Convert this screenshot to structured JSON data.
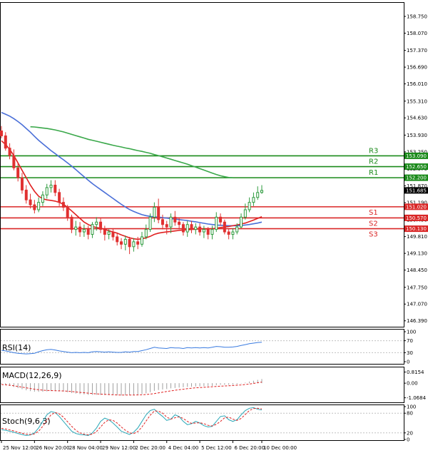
{
  "colors": {
    "bull": "#2e9b3e",
    "bear": "#e03030",
    "resistance": "#1a8a1a",
    "support": "#d92626",
    "ma_fast": "#e02020",
    "ma_mid": "#4a6fd8",
    "ma_slow": "#3aa84a",
    "rsi": "#3a7be0",
    "macd_signal": "#e02020",
    "macd_hist": "#a0a0a0",
    "stoch_main": "#2aa8b8",
    "stoch_signal": "#e02020",
    "last_price": "#000000"
  },
  "chart_data": [
    {
      "type": "candlestick",
      "x": [
        "25 Nov 12:00",
        "25 Nov 16:00",
        "25 Nov 20:00",
        "26 Nov 00:00",
        "26 Nov 04:00",
        "26 Nov 08:00",
        "26 Nov 12:00",
        "26 Nov 16:00",
        "26 Nov 20:00",
        "27 Nov 00:00",
        "27 Nov 04:00",
        "27 Nov 08:00",
        "27 Nov 12:00",
        "27 Nov 16:00",
        "27 Nov 20:00",
        "28 Nov 00:00",
        "28 Nov 04:00",
        "28 Nov 08:00",
        "28 Nov 12:00",
        "28 Nov 16:00",
        "28 Nov 20:00",
        "29 Nov 00:00",
        "29 Nov 04:00",
        "29 Nov 08:00",
        "29 Nov 12:00",
        "29 Nov 16:00",
        "29 Nov 20:00",
        "30 Nov 00:00",
        "30 Nov 04:00",
        "30 Nov 08:00",
        "2 Dec 12:00",
        "2 Dec 16:00",
        "2 Dec 20:00",
        "3 Dec 00:00",
        "3 Dec 04:00",
        "3 Dec 08:00",
        "3 Dec 12:00",
        "3 Dec 16:00",
        "3 Dec 20:00",
        "4 Dec 00:00",
        "4 Dec 04:00",
        "4 Dec 08:00",
        "4 Dec 12:00",
        "4 Dec 16:00",
        "4 Dec 20:00",
        "5 Dec 00:00",
        "5 Dec 04:00",
        "5 Dec 08:00",
        "5 Dec 12:00",
        "5 Dec 16:00",
        "5 Dec 20:00",
        "6 Dec 00:00",
        "6 Dec 04:00",
        "6 Dec 08:00",
        "6 Dec 12:00",
        "6 Dec 16:00",
        "6 Dec 20:00",
        "9 Dec 00:00",
        "9 Dec 04:00",
        "9 Dec 08:00",
        "9 Dec 12:00",
        "9 Dec 16:00",
        "9 Dec 20:00",
        "10 Dec 00:00"
      ],
      "open": [
        154.1,
        153.9,
        153.4,
        153.1,
        152.6,
        152.2,
        151.7,
        151.3,
        151.1,
        150.9,
        151.2,
        151.5,
        151.8,
        151.9,
        151.6,
        151.2,
        151.0,
        150.6,
        150.1,
        150.2,
        150.0,
        150.1,
        149.9,
        150.3,
        150.4,
        150.1,
        149.9,
        150.0,
        149.8,
        149.6,
        149.5,
        149.7,
        149.4,
        149.6,
        149.5,
        149.8,
        150.1,
        150.6,
        151.0,
        150.5,
        150.3,
        150.2,
        150.6,
        150.4,
        150.3,
        150.0,
        150.3,
        150.1,
        150.2,
        150.0,
        150.1,
        149.9,
        150.1,
        150.6,
        150.4,
        150.0,
        149.9,
        150.0,
        150.2,
        150.6,
        150.9,
        151.2,
        151.4,
        151.6
      ],
      "high": [
        154.3,
        154.05,
        153.6,
        153.35,
        152.8,
        152.4,
        151.9,
        151.55,
        151.3,
        151.4,
        151.65,
        151.95,
        152.1,
        152.1,
        151.75,
        151.4,
        151.1,
        150.7,
        150.45,
        150.4,
        150.3,
        150.25,
        150.4,
        150.6,
        150.55,
        150.25,
        150.1,
        150.15,
        149.95,
        149.75,
        149.85,
        149.8,
        149.75,
        149.8,
        150.0,
        150.3,
        150.75,
        151.2,
        151.35,
        150.7,
        150.45,
        150.75,
        150.85,
        150.55,
        150.4,
        150.45,
        150.45,
        150.35,
        150.35,
        150.25,
        150.2,
        150.25,
        150.8,
        150.75,
        150.5,
        150.15,
        150.15,
        150.35,
        150.75,
        151.15,
        151.4,
        151.6,
        151.85,
        151.9
      ],
      "low": [
        153.8,
        153.3,
        152.95,
        152.5,
        152.05,
        151.55,
        151.15,
        150.95,
        150.75,
        150.8,
        151.05,
        151.35,
        151.6,
        151.45,
        151.05,
        150.85,
        150.45,
        149.95,
        149.85,
        149.8,
        149.8,
        149.7,
        149.75,
        150.05,
        149.95,
        149.65,
        149.7,
        149.65,
        149.45,
        149.3,
        149.25,
        149.1,
        149.2,
        149.3,
        149.4,
        149.7,
        150.0,
        150.4,
        150.35,
        150.1,
        149.9,
        149.95,
        150.25,
        150.1,
        149.85,
        149.8,
        149.95,
        149.9,
        149.85,
        149.75,
        149.7,
        149.7,
        150.0,
        150.25,
        149.9,
        149.7,
        149.7,
        149.9,
        150.15,
        150.5,
        150.8,
        151.05,
        151.3,
        151.55
      ],
      "close": [
        153.9,
        153.4,
        153.1,
        152.6,
        152.2,
        151.7,
        151.3,
        151.1,
        150.9,
        151.2,
        151.5,
        151.8,
        151.9,
        151.6,
        151.2,
        151.0,
        150.6,
        150.1,
        150.2,
        150.0,
        150.1,
        149.9,
        150.3,
        150.4,
        150.1,
        149.9,
        150.0,
        149.8,
        149.6,
        149.5,
        149.7,
        149.4,
        149.6,
        149.5,
        149.8,
        150.1,
        150.6,
        151.0,
        150.5,
        150.3,
        150.2,
        150.6,
        150.4,
        150.3,
        150.0,
        150.3,
        150.1,
        150.2,
        150.0,
        150.1,
        149.9,
        150.1,
        150.6,
        150.4,
        150.0,
        149.9,
        150.0,
        150.2,
        150.6,
        150.9,
        151.2,
        151.4,
        151.6,
        151.685
      ],
      "y_ticks": [
        "158.750",
        "158.070",
        "157.370",
        "156.690",
        "156.010",
        "155.310",
        "154.630",
        "153.930",
        "153.250",
        "152.570",
        "151.870",
        "151.190",
        "150.490",
        "149.810",
        "149.130",
        "148.450",
        "147.750",
        "147.070",
        "146.390"
      ],
      "ylim": [
        146.15,
        159.3
      ],
      "x_tick_labels": [
        "25 Nov 12:00",
        "26 Nov 20:00",
        "28 Nov 04:00",
        "29 Nov 12:00",
        "2 Dec 20:00",
        "4 Dec 04:00",
        "5 Dec 12:00",
        "6 Dec 20:00",
        "10 Dec 00:00"
      ],
      "last_price": "151.685",
      "levels": [
        {
          "name": "R3",
          "value": 153.09,
          "tag": "153.090",
          "kind": "resistance"
        },
        {
          "name": "R2",
          "value": 152.65,
          "tag": "152.650",
          "kind": "resistance"
        },
        {
          "name": "R1",
          "value": 152.2,
          "tag": "152.200",
          "kind": "resistance"
        },
        {
          "name": "S1",
          "value": 151.02,
          "tag": "151.020",
          "kind": "support"
        },
        {
          "name": "S2",
          "value": 150.57,
          "tag": "150.570",
          "kind": "support"
        },
        {
          "name": "S3",
          "value": 150.13,
          "tag": "150.130",
          "kind": "support"
        }
      ],
      "ma_fast": [
        153.7,
        153.55,
        153.35,
        153.1,
        152.8,
        152.5,
        152.2,
        151.9,
        151.65,
        151.45,
        151.35,
        151.3,
        151.28,
        151.25,
        151.2,
        151.12,
        151.0,
        150.85,
        150.7,
        150.55,
        150.4,
        150.3,
        150.22,
        150.18,
        150.15,
        150.1,
        150.05,
        150.0,
        149.95,
        149.88,
        149.82,
        149.76,
        149.72,
        149.7,
        149.72,
        149.76,
        149.82,
        149.9,
        149.95,
        149.98,
        150.0,
        150.02,
        150.04,
        150.06,
        150.08,
        150.08,
        150.1,
        150.11,
        150.12,
        150.12,
        150.12,
        150.13,
        150.15,
        150.18,
        150.2,
        150.22,
        150.25,
        150.28,
        150.32,
        150.36,
        150.42,
        150.48,
        150.55,
        150.62
      ],
      "ma_mid": [
        154.85,
        154.78,
        154.7,
        154.6,
        154.48,
        154.35,
        154.2,
        154.05,
        153.88,
        153.72,
        153.58,
        153.44,
        153.3,
        153.18,
        153.05,
        152.93,
        152.8,
        152.67,
        152.53,
        152.38,
        152.24,
        152.1,
        151.96,
        151.84,
        151.72,
        151.6,
        151.48,
        151.36,
        151.24,
        151.12,
        151.01,
        150.91,
        150.83,
        150.76,
        150.7,
        150.66,
        150.63,
        150.61,
        150.6,
        150.58,
        150.56,
        150.54,
        150.52,
        150.5,
        150.48,
        150.46,
        150.43,
        150.41,
        150.38,
        150.35,
        150.32,
        150.3,
        150.28,
        150.27,
        150.26,
        150.25,
        150.25,
        150.25,
        150.26,
        150.28,
        150.3,
        150.33,
        150.36,
        150.4
      ],
      "ma_slow": [
        null,
        null,
        null,
        null,
        null,
        null,
        null,
        154.27,
        154.26,
        154.24,
        154.22,
        154.2,
        154.17,
        154.14,
        154.1,
        154.06,
        154.01,
        153.96,
        153.91,
        153.86,
        153.81,
        153.76,
        153.72,
        153.68,
        153.64,
        153.6,
        153.56,
        153.52,
        153.48,
        153.45,
        153.41,
        153.38,
        153.34,
        153.3,
        153.27,
        153.23,
        153.19,
        153.14,
        153.1,
        153.05,
        153.0,
        152.95,
        152.9,
        152.85,
        152.8,
        152.75,
        152.69,
        152.63,
        152.57,
        152.51,
        152.45,
        152.39,
        152.33,
        152.28,
        152.24,
        152.21,
        152.2,
        null,
        null,
        null,
        null,
        null,
        null,
        null
      ]
    },
    {
      "type": "line",
      "title": "RSI(14)",
      "y_ticks": [
        "100",
        "70",
        "30",
        "0"
      ],
      "ylim": [
        0,
        100
      ],
      "values": [
        38,
        36,
        33,
        30,
        28,
        27,
        26,
        27,
        28,
        33,
        37,
        40,
        41,
        39,
        36,
        34,
        32,
        30,
        31,
        30,
        31,
        30,
        33,
        34,
        33,
        32,
        33,
        32,
        31,
        31,
        33,
        32,
        34,
        34,
        37,
        40,
        44,
        48,
        46,
        45,
        44,
        47,
        46,
        46,
        44,
        47,
        46,
        47,
        46,
        47,
        46,
        48,
        51,
        50,
        48,
        48,
        49,
        51,
        54,
        57,
        60,
        62,
        64,
        65
      ]
    },
    {
      "type": "bar",
      "title": "MACD(12,26,9)",
      "y_ticks": [
        "0.8154",
        "0.00",
        "-1.0684"
      ],
      "ylim": [
        -1.35,
        1.05
      ],
      "histogram": [
        -0.05,
        -0.12,
        -0.2,
        -0.28,
        -0.36,
        -0.44,
        -0.52,
        -0.58,
        -0.62,
        -0.63,
        -0.62,
        -0.6,
        -0.58,
        -0.58,
        -0.6,
        -0.62,
        -0.66,
        -0.72,
        -0.76,
        -0.8,
        -0.82,
        -0.85,
        -0.85,
        -0.85,
        -0.86,
        -0.87,
        -0.87,
        -0.88,
        -0.89,
        -0.9,
        -0.88,
        -0.88,
        -0.86,
        -0.84,
        -0.8,
        -0.74,
        -0.66,
        -0.56,
        -0.5,
        -0.46,
        -0.43,
        -0.38,
        -0.35,
        -0.32,
        -0.3,
        -0.27,
        -0.26,
        -0.24,
        -0.23,
        -0.22,
        -0.22,
        -0.2,
        -0.15,
        -0.12,
        -0.12,
        -0.12,
        -0.11,
        -0.08,
        -0.03,
        0.04,
        0.12,
        0.18,
        0.24,
        0.3
      ],
      "signal": [
        -0.1,
        -0.12,
        -0.15,
        -0.19,
        -0.24,
        -0.29,
        -0.34,
        -0.39,
        -0.44,
        -0.48,
        -0.51,
        -0.53,
        -0.54,
        -0.55,
        -0.56,
        -0.57,
        -0.59,
        -0.61,
        -0.64,
        -0.67,
        -0.7,
        -0.73,
        -0.76,
        -0.78,
        -0.8,
        -0.82,
        -0.83,
        -0.85,
        -0.86,
        -0.87,
        -0.87,
        -0.87,
        -0.87,
        -0.86,
        -0.85,
        -0.83,
        -0.8,
        -0.76,
        -0.71,
        -0.66,
        -0.61,
        -0.56,
        -0.52,
        -0.48,
        -0.44,
        -0.4,
        -0.37,
        -0.34,
        -0.32,
        -0.3,
        -0.28,
        -0.26,
        -0.24,
        -0.22,
        -0.2,
        -0.19,
        -0.17,
        -0.15,
        -0.13,
        -0.1,
        -0.06,
        -0.02,
        0.03,
        0.08
      ]
    },
    {
      "type": "line",
      "title": "Stoch(9,6,3)",
      "y_ticks": [
        "100",
        "80",
        "20",
        "0"
      ],
      "ylim": [
        0,
        100
      ],
      "main": [
        30,
        28,
        25,
        22,
        18,
        15,
        12,
        14,
        20,
        35,
        55,
        75,
        85,
        82,
        70,
        55,
        40,
        25,
        18,
        15,
        14,
        12,
        20,
        35,
        55,
        65,
        60,
        50,
        38,
        25,
        20,
        15,
        22,
        35,
        55,
        75,
        88,
        92,
        80,
        70,
        58,
        62,
        75,
        70,
        55,
        45,
        48,
        55,
        50,
        42,
        38,
        40,
        55,
        70,
        72,
        60,
        55,
        60,
        75,
        88,
        95,
        97,
        92,
        90
      ],
      "signal": [
        34,
        32,
        29,
        26,
        22,
        19,
        16,
        15,
        17,
        25,
        40,
        58,
        75,
        82,
        78,
        68,
        54,
        40,
        28,
        20,
        16,
        14,
        16,
        24,
        38,
        52,
        60,
        58,
        50,
        38,
        28,
        20,
        18,
        24,
        38,
        56,
        74,
        87,
        86,
        80,
        68,
        62,
        66,
        69,
        64,
        55,
        49,
        50,
        51,
        48,
        43,
        41,
        46,
        55,
        66,
        68,
        62,
        58,
        64,
        76,
        88,
        94,
        95,
        93
      ]
    }
  ]
}
